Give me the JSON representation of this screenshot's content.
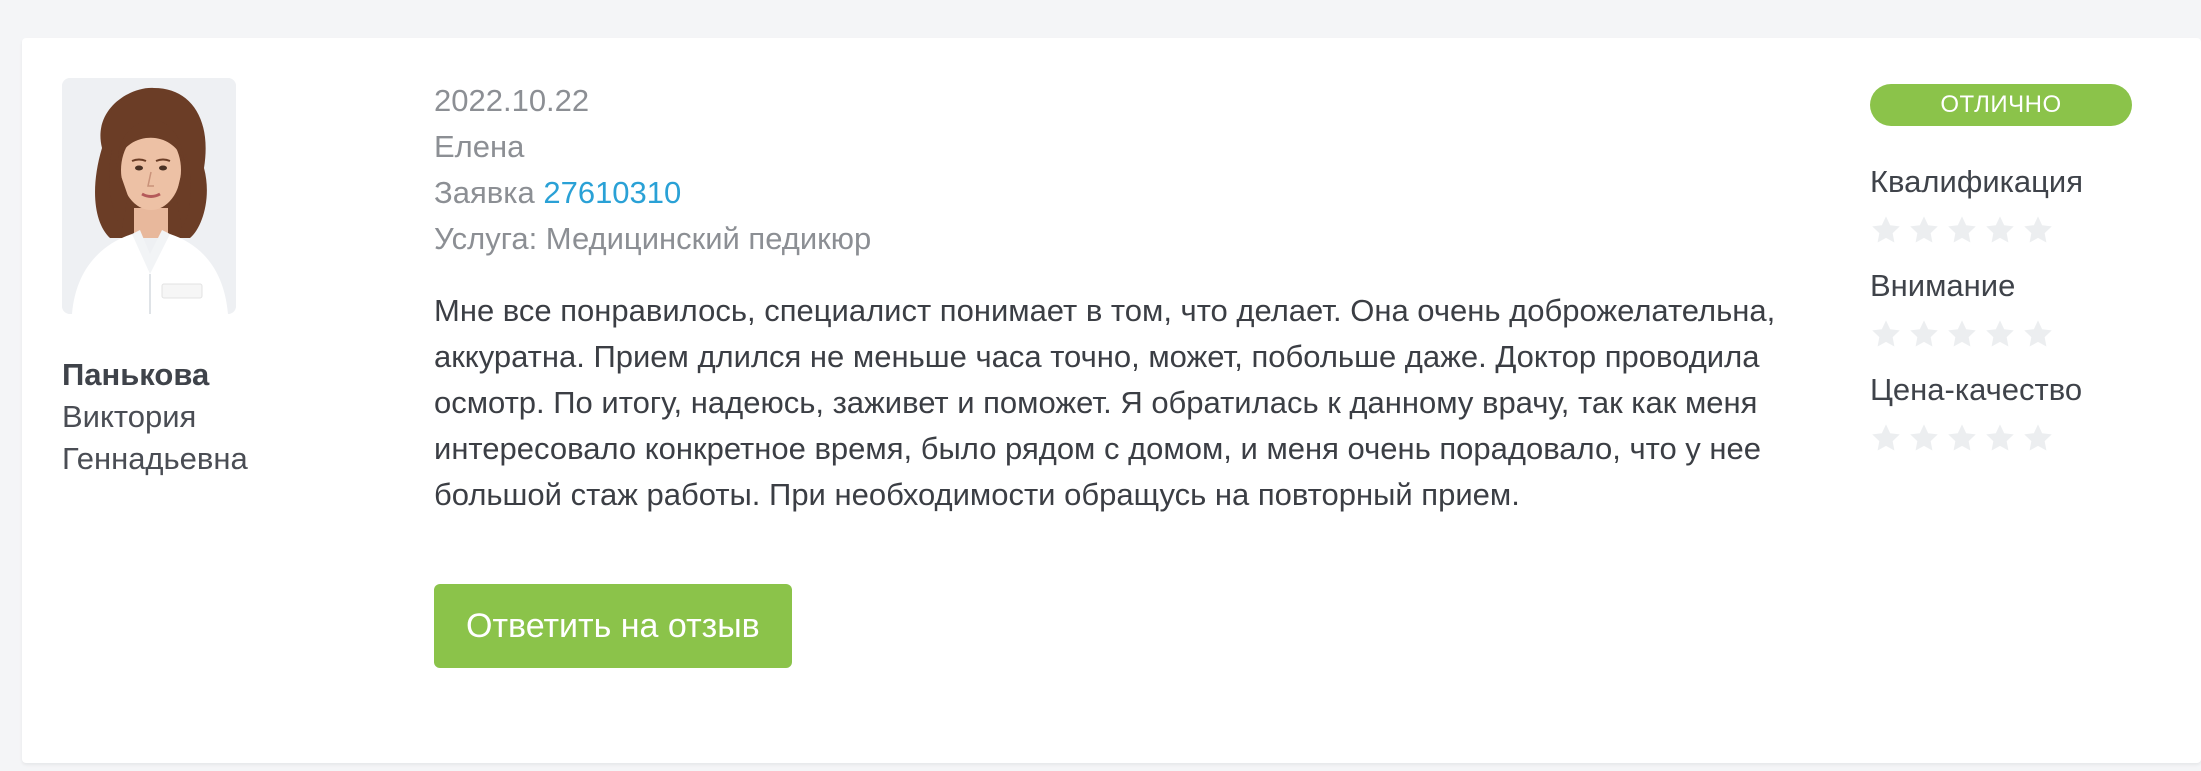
{
  "doctor": {
    "surname": "Панькова",
    "first_name": "Виктория",
    "patronymic": "Геннадьевна"
  },
  "review": {
    "date": "2022.10.22",
    "author": "Елена",
    "request_label": "Заявка",
    "request_number": "27610310",
    "service": "Услуга: Медицинский педикюр",
    "text": "Мне все понравилось, специалист понимает в том, что делает. Она очень доброжелательна, аккуратна. Прием длился не меньше часа точно, может, побольше даже. Доктор проводила осмотр. По итогу, надеюсь, заживет и поможет. Я обратилась к данному врачу, так как меня интересовало конкретное время, было рядом с домом, и меня очень порадовало, что у нее большой стаж работы. При необходимости обращусь на повторный прием.",
    "reply_button": "Ответить на отзыв"
  },
  "ratings": {
    "badge": "ОТЛИЧНО",
    "criteria": [
      {
        "label": "Квалификация",
        "stars_filled": 0,
        "stars_total": 5
      },
      {
        "label": "Внимание",
        "stars_filled": 0,
        "stars_total": 5
      },
      {
        "label": "Цена-качество",
        "stars_filled": 0,
        "stars_total": 5
      }
    ]
  },
  "colors": {
    "accent_green": "#8bc34a",
    "link_blue": "#2aa1d6",
    "star_empty": "#eceef0"
  }
}
